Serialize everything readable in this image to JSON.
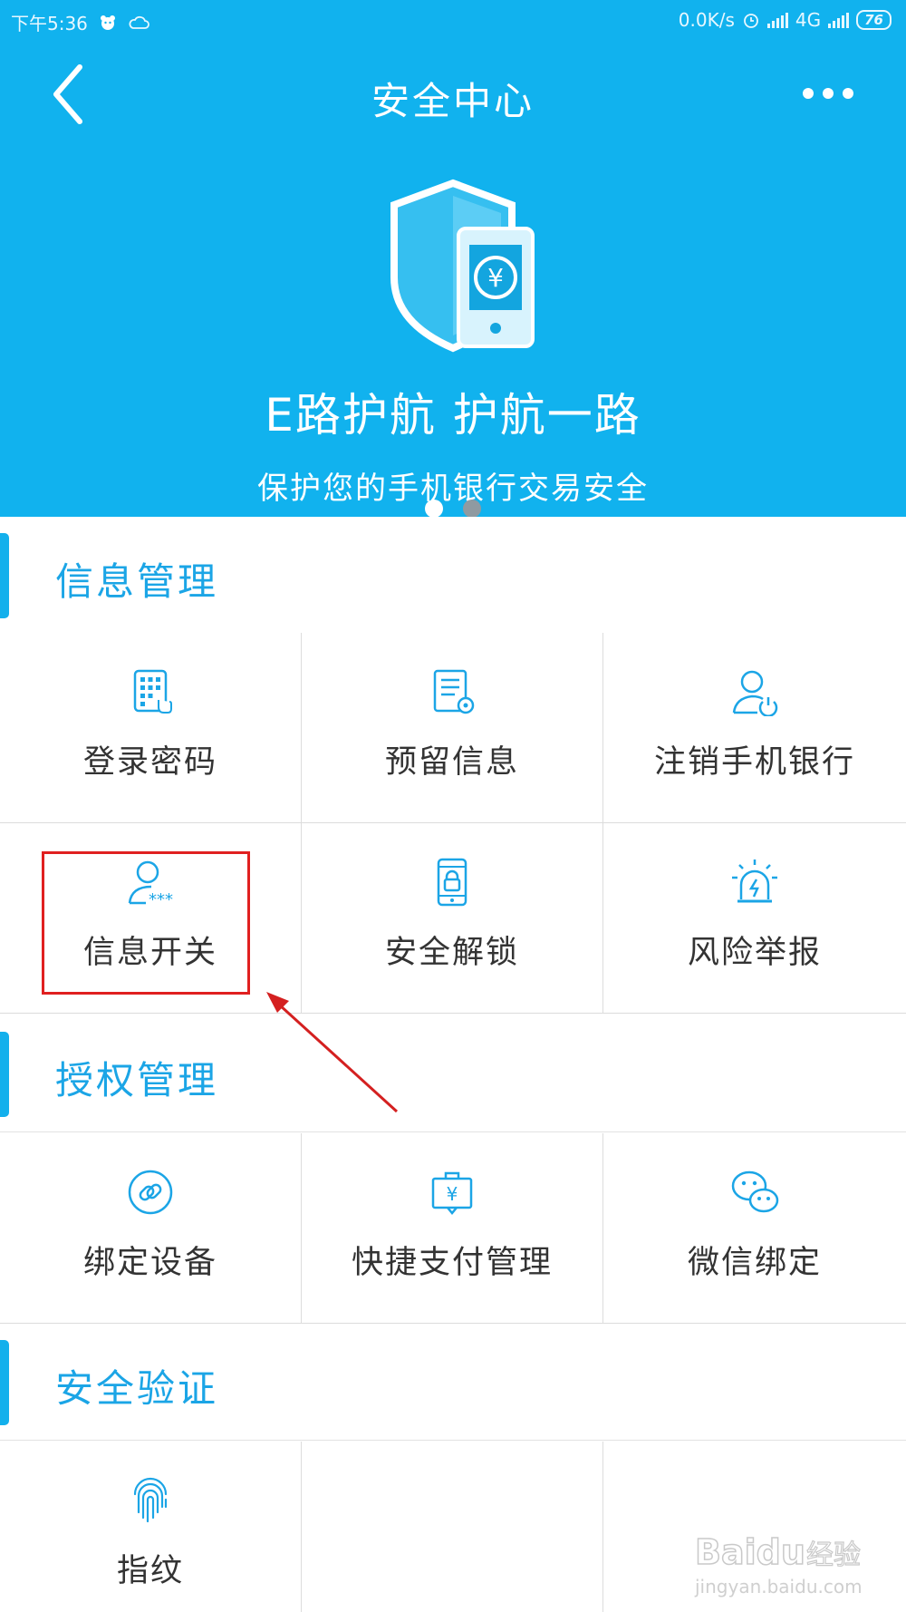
{
  "status_bar": {
    "time": "下午5:36",
    "speed": "0.0K/s",
    "network": "4G",
    "battery": "76"
  },
  "header": {
    "title": "安全中心"
  },
  "banner": {
    "slogan": "E路护航 护航一路",
    "subslogan": "保护您的手机银行交易安全",
    "page_count": 2,
    "active_page": 1
  },
  "sections": [
    {
      "title": "信息管理",
      "items": [
        {
          "label": "登录密码",
          "icon": "keypad-icon"
        },
        {
          "label": "预留信息",
          "icon": "document-gear-icon"
        },
        {
          "label": "注销手机银行",
          "icon": "user-power-icon"
        },
        {
          "label": "信息开关",
          "icon": "user-asterisk-icon"
        },
        {
          "label": "安全解锁",
          "icon": "phone-lock-icon"
        },
        {
          "label": "风险举报",
          "icon": "alarm-icon"
        }
      ]
    },
    {
      "title": "授权管理",
      "items": [
        {
          "label": "绑定设备",
          "icon": "link-icon"
        },
        {
          "label": "快捷支付管理",
          "icon": "yuan-bag-icon"
        },
        {
          "label": "微信绑定",
          "icon": "wechat-icon"
        }
      ]
    },
    {
      "title": "安全验证",
      "items": [
        {
          "label": "指纹",
          "icon": "fingerprint-icon"
        }
      ]
    }
  ],
  "watermark": {
    "brand": "Baidu",
    "brand_cn": "经验",
    "url": "jingyan.baidu.com"
  },
  "colors": {
    "hero_bg": "#11b2ee",
    "accent": "#1ba5e6",
    "highlight": "#e02020"
  }
}
